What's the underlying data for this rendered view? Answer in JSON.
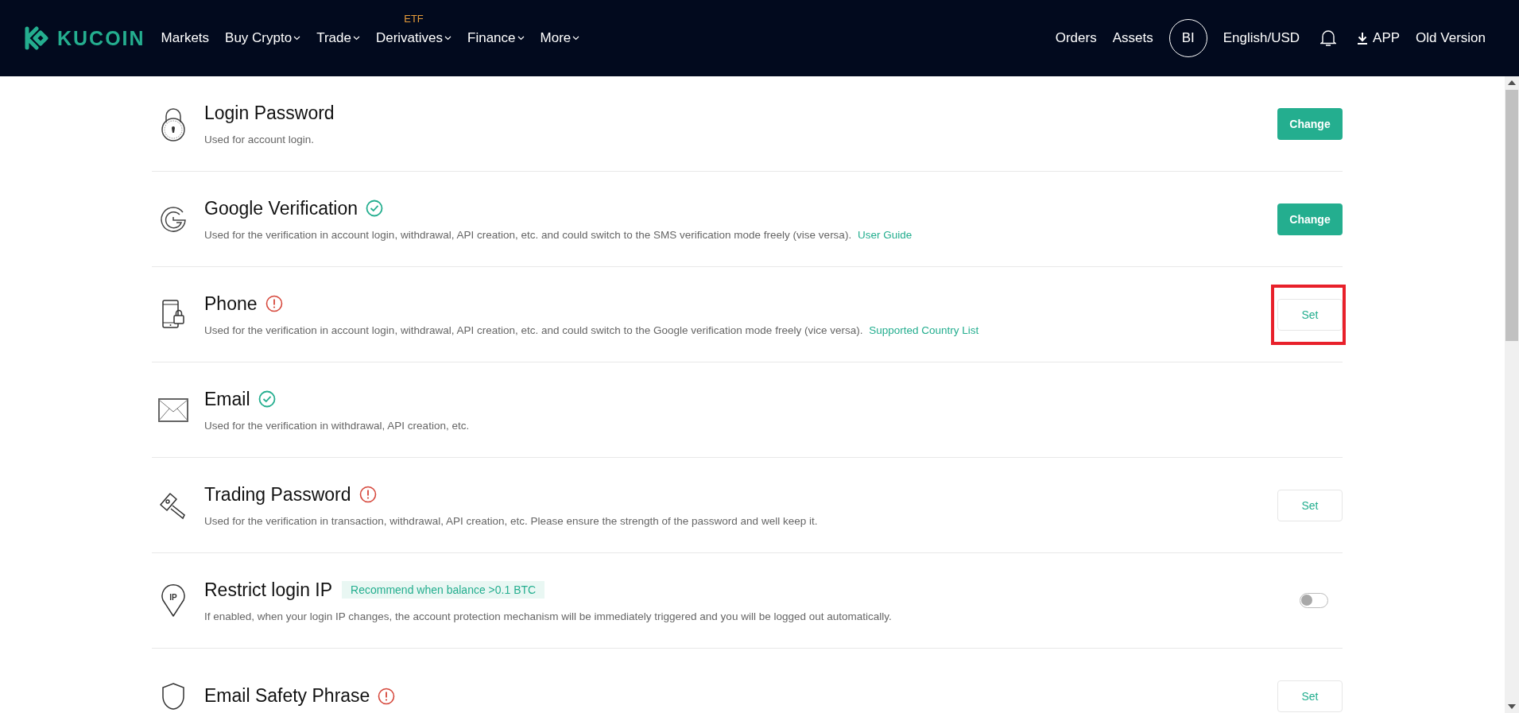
{
  "header": {
    "logo": "KUCOIN",
    "nav": [
      {
        "label": "Markets",
        "has_menu": false
      },
      {
        "label": "Buy Crypto",
        "has_menu": true
      },
      {
        "label": "Trade",
        "has_menu": true
      },
      {
        "label": "Derivatives",
        "has_menu": true,
        "badge": "ETF"
      },
      {
        "label": "Finance",
        "has_menu": true
      },
      {
        "label": "More",
        "has_menu": true
      }
    ],
    "right": [
      {
        "kind": "link",
        "label": "Orders"
      },
      {
        "kind": "link",
        "label": "Assets"
      },
      {
        "kind": "avatar",
        "label": "BI"
      },
      {
        "kind": "link",
        "label": "English/USD"
      },
      {
        "kind": "bell"
      },
      {
        "kind": "download",
        "label": "APP"
      },
      {
        "kind": "link",
        "label": "Old Version"
      }
    ]
  },
  "settings": [
    {
      "title": "Login Password",
      "description": "Used for account login.",
      "action": {
        "kind": "primary",
        "label": "Change",
        "highlighted": false
      }
    },
    {
      "title": "Google Verification",
      "verified": true,
      "description": "Used for the verification in account login, withdrawal, API creation, etc. and could switch to the SMS verification mode freely (vise versa).",
      "link": "User Guide",
      "action": {
        "kind": "primary",
        "label": "Change",
        "highlighted": false
      }
    },
    {
      "title": "Phone",
      "verified": false,
      "description": "Used for the verification in account login, withdrawal, API creation, etc. and could switch to the Google verification mode freely (vice versa).",
      "link": "Supported Country List",
      "action": {
        "kind": "outline",
        "label": "Set",
        "highlighted": true
      }
    },
    {
      "title": "Email",
      "verified": true,
      "description": "Used for the verification in withdrawal, API creation, etc."
    },
    {
      "title": "Trading Password",
      "verified": false,
      "description": "Used for the verification in transaction, withdrawal, API creation, etc. Please ensure the strength of the password and well keep it.",
      "action": {
        "kind": "outline",
        "label": "Set",
        "highlighted": false
      }
    },
    {
      "title": "Restrict login IP",
      "icon_text": "IP",
      "tag": "Recommend when balance >0.1 BTC",
      "description": "If enabled, when your login IP changes, the account protection mechanism will be immediately triggered and you will be logged out automatically.",
      "action": {
        "kind": "toggle",
        "on": false
      }
    },
    {
      "title": "Email Safety Phrase",
      "verified": false,
      "action": {
        "kind": "outline",
        "label": "Set",
        "highlighted": false
      }
    }
  ]
}
